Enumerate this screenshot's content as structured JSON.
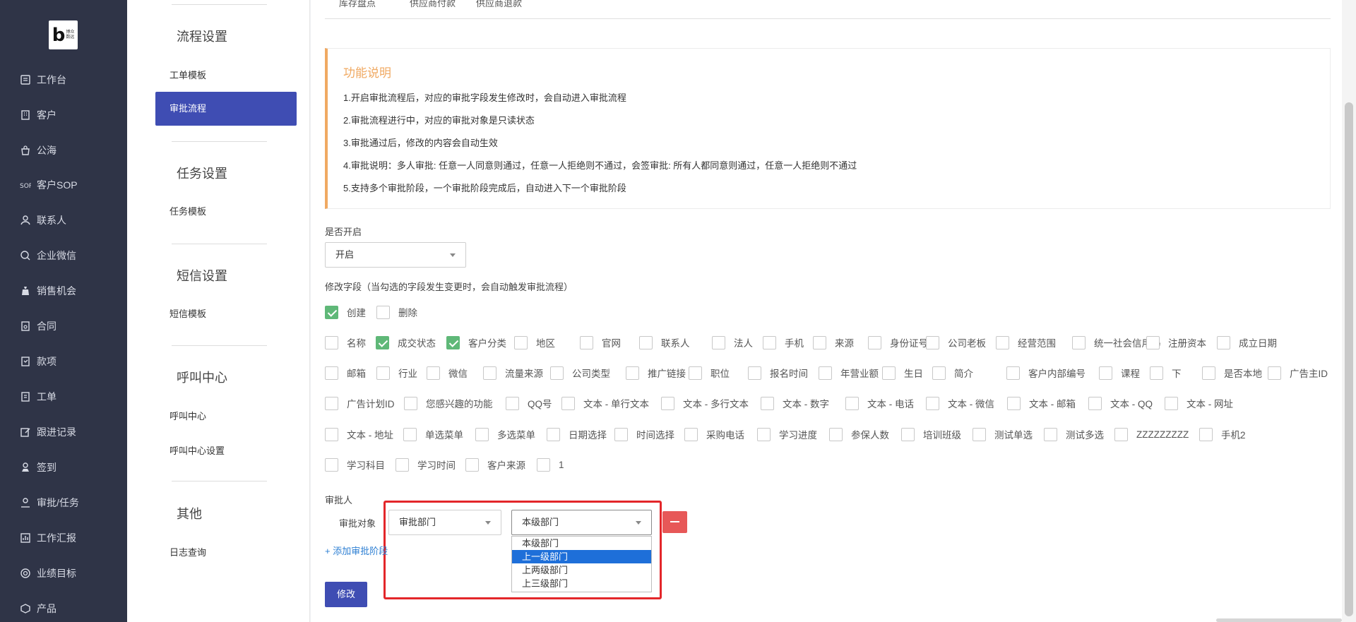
{
  "logo": {
    "mark": "b",
    "text": "博众数远"
  },
  "nav": [
    {
      "label": "工作台",
      "icon": "dashboard-icon"
    },
    {
      "label": "客户",
      "icon": "building-icon"
    },
    {
      "label": "公海",
      "icon": "bag-icon"
    },
    {
      "label": "客户SOP",
      "icon": "sop-icon"
    },
    {
      "label": "联系人",
      "icon": "contact-icon"
    },
    {
      "label": "企业微信",
      "icon": "chat-icon"
    },
    {
      "label": "销售机会",
      "icon": "moneybag-icon"
    },
    {
      "label": "合同",
      "icon": "contract-icon"
    },
    {
      "label": "款项",
      "icon": "payment-icon"
    },
    {
      "label": "工单",
      "icon": "ticket-icon"
    },
    {
      "label": "跟进记录",
      "icon": "edit-icon"
    },
    {
      "label": "签到",
      "icon": "checkin-icon"
    },
    {
      "label": "审批/任务",
      "icon": "user-icon"
    },
    {
      "label": "工作汇报",
      "icon": "report-icon"
    },
    {
      "label": "业绩目标",
      "icon": "target-icon"
    },
    {
      "label": "产品",
      "icon": "product-icon"
    }
  ],
  "subnav": {
    "flow_title": "流程设置",
    "ticket_template": "工单模板",
    "approval_flow": "审批流程",
    "task_title": "任务设置",
    "task_template": "任务模板",
    "sms_title": "短信设置",
    "sms_template": "短信模板",
    "call_title": "呼叫中心",
    "call_center": "呼叫中心",
    "call_center_settings": "呼叫中心设置",
    "other_title": "其他",
    "log_query": "日志查询"
  },
  "tabs": [
    "库存盘点",
    "供应商付款",
    "供应商退款"
  ],
  "info": {
    "title": "功能说明",
    "lines": [
      "1.开启审批流程后，对应的审批字段发生修改时，会自动进入审批流程",
      "2.审批流程进行中，对应的审批对象是只读状态",
      "3.审批通过后，修改的内容会自动生效",
      "4.审批说明：多人审批: 任意一人同意则通过，任意一人拒绝则不通过，会签审批: 所有人都同意则通过，任意一人拒绝则不通过",
      "5.支持多个审批阶段，一个审批阶段完成后，自动进入下一个审批阶段"
    ]
  },
  "enable": {
    "label": "是否开启",
    "value": "开启"
  },
  "fields": {
    "label": "修改字段（当勾选的字段发生变更时，会自动触发审批流程）",
    "row0": [
      {
        "text": "创建",
        "checked": true
      },
      {
        "text": "删除",
        "checked": false
      }
    ],
    "row1": [
      {
        "text": "名称",
        "checked": false
      },
      {
        "text": "成交状态",
        "checked": true
      },
      {
        "text": "客户分类",
        "checked": true
      },
      {
        "text": "地区",
        "checked": false
      },
      {
        "text": "官网",
        "checked": false
      },
      {
        "text": "联系人",
        "checked": false
      },
      {
        "text": "法人",
        "checked": false
      },
      {
        "text": "手机",
        "checked": false
      },
      {
        "text": "来源",
        "checked": false
      },
      {
        "text": "身份证号",
        "checked": false
      },
      {
        "text": "公司老板",
        "checked": false
      },
      {
        "text": "经营范围",
        "checked": false
      },
      {
        "text": "统一社会信用码",
        "checked": false
      },
      {
        "text": "注册资本",
        "checked": false
      },
      {
        "text": "成立日期",
        "checked": false
      }
    ],
    "row2": [
      {
        "text": "邮箱",
        "checked": false
      },
      {
        "text": "行业",
        "checked": false
      },
      {
        "text": "微信",
        "checked": false
      },
      {
        "text": "流量来源",
        "checked": false
      },
      {
        "text": "公司类型",
        "checked": false
      },
      {
        "text": "推广链接",
        "checked": false
      },
      {
        "text": "职位",
        "checked": false
      },
      {
        "text": "报名时间",
        "checked": false
      },
      {
        "text": "年营业额",
        "checked": false
      },
      {
        "text": "生日",
        "checked": false
      },
      {
        "text": "简介",
        "checked": false
      },
      {
        "text": "客户内部编号",
        "checked": false
      },
      {
        "text": "课程",
        "checked": false
      },
      {
        "text": "下",
        "checked": false
      },
      {
        "text": "是否本地",
        "checked": false
      },
      {
        "text": "广告主ID",
        "checked": false
      }
    ],
    "row3": [
      {
        "text": "广告计划ID",
        "checked": false
      },
      {
        "text": "您感兴趣的功能",
        "checked": false
      },
      {
        "text": "QQ号",
        "checked": false
      },
      {
        "text": "文本 - 单行文本",
        "checked": false
      },
      {
        "text": "文本 - 多行文本",
        "checked": false
      },
      {
        "text": "文本 - 数字",
        "checked": false
      },
      {
        "text": "文本 - 电话",
        "checked": false
      },
      {
        "text": "文本 - 微信",
        "checked": false
      },
      {
        "text": "文本 - 邮箱",
        "checked": false
      },
      {
        "text": "文本 - QQ",
        "checked": false
      },
      {
        "text": "文本 - 网址",
        "checked": false
      }
    ],
    "row4": [
      {
        "text": "文本 - 地址",
        "checked": false
      },
      {
        "text": "单选菜单",
        "checked": false
      },
      {
        "text": "多选菜单",
        "checked": false
      },
      {
        "text": "日期选择",
        "checked": false
      },
      {
        "text": "时间选择",
        "checked": false
      },
      {
        "text": "采购电话",
        "checked": false
      },
      {
        "text": "学习进度",
        "checked": false
      },
      {
        "text": "参保人数",
        "checked": false
      },
      {
        "text": "培训班级",
        "checked": false
      },
      {
        "text": "测试单选",
        "checked": false
      },
      {
        "text": "测试多选",
        "checked": false
      },
      {
        "text": "ZZZZZZZZZ",
        "checked": false
      },
      {
        "text": "手机2",
        "checked": false
      }
    ],
    "row5": [
      {
        "text": "学习科目",
        "checked": false
      },
      {
        "text": "学习时间",
        "checked": false
      },
      {
        "text": "客户来源",
        "checked": false
      },
      {
        "text": "1",
        "checked": false
      }
    ]
  },
  "approver": {
    "label": "审批人",
    "object_label": "审批对象",
    "object_value": "审批部门",
    "level_value": "本级部门",
    "options": [
      "本级部门",
      "上一级部门",
      "上两级部门",
      "上三级部门"
    ],
    "highlighted": "上一级部门"
  },
  "add_stage": "+ 添加审批阶段",
  "submit": "修改",
  "colors": {
    "primary": "#3f4db3",
    "accent": "#f0a962",
    "check": "#5fb878",
    "danger": "#e75858",
    "highlight": "#e3262a"
  }
}
